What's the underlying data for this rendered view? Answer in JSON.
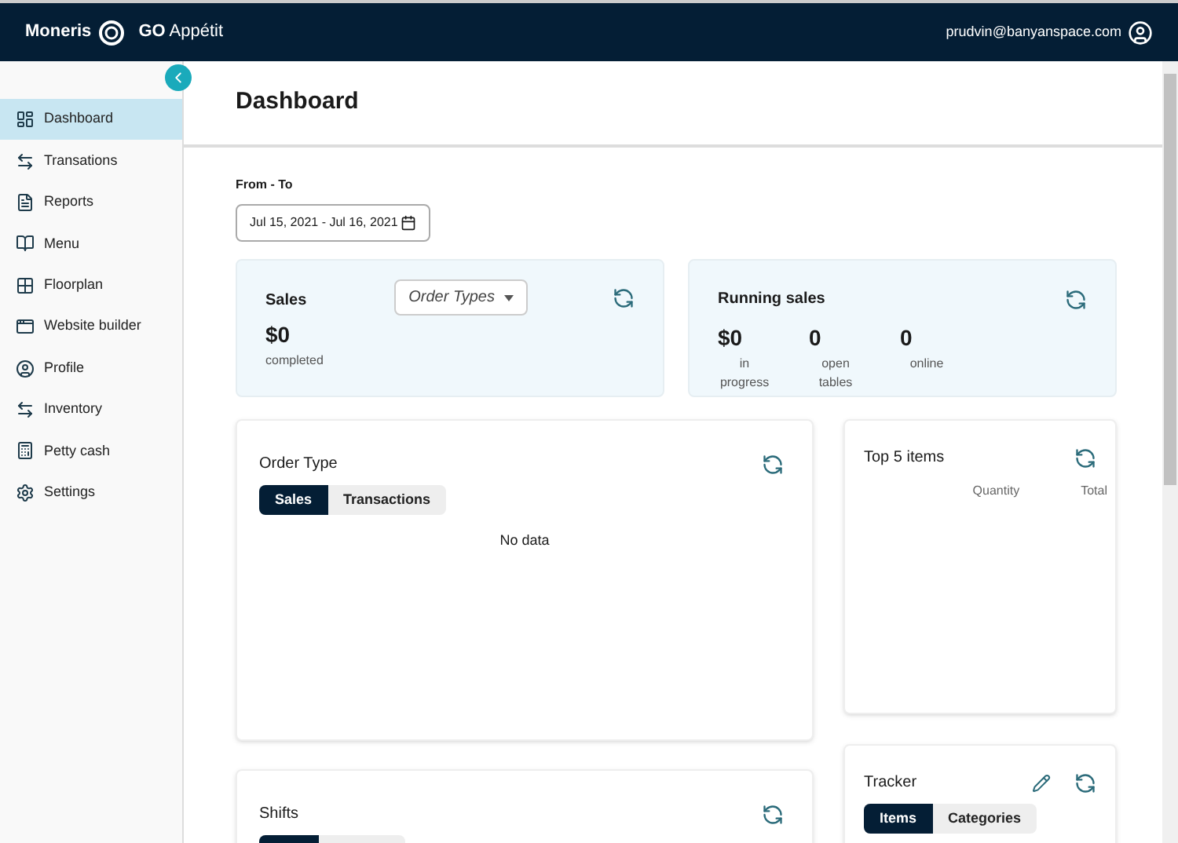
{
  "header": {
    "brand": "Moneris",
    "product_bold": "GO",
    "product": "Appétit",
    "user": "prudvin@banyanspace.com"
  },
  "sidebar": {
    "items": [
      {
        "label": "Dashboard",
        "selected": true
      },
      {
        "label": "Transations",
        "selected": false
      },
      {
        "label": "Reports",
        "selected": false
      },
      {
        "label": "Menu",
        "selected": false
      },
      {
        "label": "Floorplan",
        "selected": false
      },
      {
        "label": "Website builder",
        "selected": false
      },
      {
        "label": "Profile",
        "selected": false
      },
      {
        "label": "Inventory",
        "selected": false
      },
      {
        "label": "Petty cash",
        "selected": false
      },
      {
        "label": "Settings",
        "selected": false
      }
    ]
  },
  "page": {
    "title": "Dashboard",
    "date_label": "From - To",
    "date_range": "Jul 15, 2021 - Jul 16, 2021"
  },
  "sales": {
    "title": "Sales",
    "dropdown": "Order Types",
    "value": "$0",
    "caption": "completed"
  },
  "running_sales": {
    "title": "Running sales",
    "stats": [
      {
        "value": "$0",
        "caption": "in progress"
      },
      {
        "value": "0",
        "caption": "open tables"
      },
      {
        "value": "0",
        "caption": "online"
      }
    ]
  },
  "order_type": {
    "title": "Order Type",
    "tabs": [
      {
        "label": "Sales",
        "selected": true
      },
      {
        "label": "Transactions",
        "selected": false
      }
    ],
    "empty": "No data"
  },
  "top_items": {
    "title": "Top 5 items",
    "columns": [
      "Quantity",
      "Total"
    ]
  },
  "shifts": {
    "title": "Shifts"
  },
  "tracker": {
    "title": "Tracker",
    "tabs": [
      {
        "label": "Items",
        "selected": true
      },
      {
        "label": "Categories",
        "selected": false
      }
    ]
  }
}
